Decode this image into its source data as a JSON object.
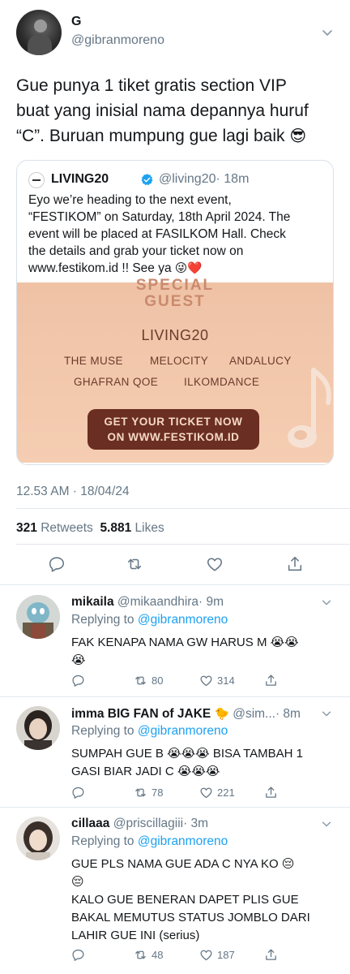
{
  "main_tweet": {
    "name": "G",
    "handle": "@gibranmoreno",
    "text_lines": [
      "Gue punya 1 tiket gratis section VIP",
      "buat yang inisial nama depannya huruf",
      "“C”. Buruan mumpung gue lagi baik"
    ],
    "emoji": "😎",
    "timestamp": "12.53 AM · 18/04/24",
    "retweets_count": "321",
    "retweets_label": "Retweets",
    "likes_count": "5.881",
    "likes_label": "Likes"
  },
  "quoted": {
    "name": "LIVING20",
    "handle": "@living20",
    "time": "· 18m",
    "text_lines": [
      "Eyo we’re heading to the next event,",
      "“FESTIKOM” on Saturday, 18th April 2024. The",
      "event will be placed at FASILKOM Hall. Check",
      "the details and grab your ticket now on"
    ],
    "text_last": "www.festikom.id !! See ya",
    "emojis": "😜❤️",
    "poster": {
      "title_line1": "SPECIAL",
      "title_line2": "GUEST",
      "headliner": "LIVING20",
      "performers": [
        "THE MUSE",
        "MELOCITY",
        "ANDALUCY",
        "GHAFRAN QOE",
        "ILKOMDANCE"
      ],
      "cta_line1": "GET YOUR TICKET NOW",
      "cta_line2": "ON WWW.FESTIKOM.ID"
    }
  },
  "replies": [
    {
      "name": "mikaila",
      "handle": "@mikaandhira",
      "time": "· 9m",
      "replying_prefix": "Replying to",
      "replying_to": "@gibranmoreno",
      "text_lines": [
        "FAK KENAPA NAMA GW HARUS M 😭😭",
        "😭"
      ],
      "retweets": "80",
      "likes": "314"
    },
    {
      "name": "imma BIG FAN of JAKE",
      "name_emoji": "🐤",
      "handle": "@sim...",
      "time": "· 8m",
      "replying_prefix": "Replying to",
      "replying_to": "@gibranmoreno",
      "text_lines": [
        "SUMPAH GUE B 😭😭😭  BISA TAMBAH 1",
        "GASI BIAR JADI C 😭😭😭"
      ],
      "retweets": "78",
      "likes": "221"
    },
    {
      "name": "cillaaa",
      "handle": "@priscillagiii",
      "time": "· 3m",
      "replying_prefix": "Replying to",
      "replying_to": "@gibranmoreno",
      "text_lines": [
        "GUE PLS NAMA GUE ADA C NYA KO 😔",
        "😔",
        "KALO GUE BENERAN DAPET PLIS GUE",
        "BAKAL MEMUTUS STATUS JOMBLO DARI",
        "LAHIR GUE INI (serius)"
      ],
      "retweets": "48",
      "likes": "187"
    }
  ],
  "colors": {
    "link": "#1da1f2",
    "muted": "#657786",
    "text": "#14171a",
    "divider": "#e1e8ed",
    "poster_bg": "#f3c9ad",
    "cta_bg": "#6b2e22"
  },
  "icons": [
    "chevron-down-icon",
    "verified-badge-icon",
    "reply-icon",
    "retweet-icon",
    "like-icon",
    "share-icon",
    "music-note-icon"
  ]
}
